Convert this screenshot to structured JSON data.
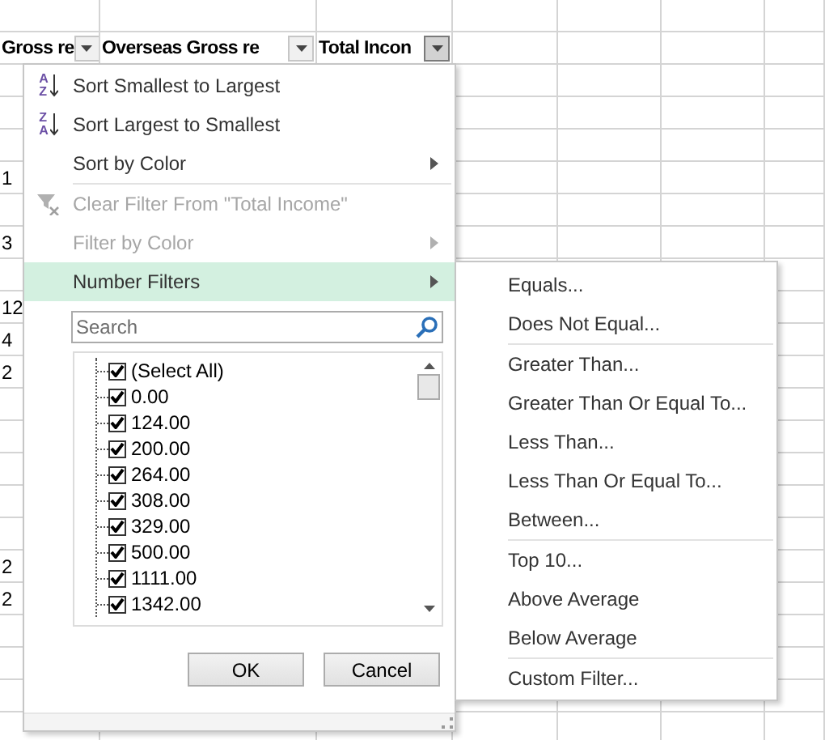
{
  "sheet": {
    "headers": [
      {
        "label": "Gross re",
        "filter_active": false
      },
      {
        "label": "Overseas Gross re",
        "filter_active": false
      },
      {
        "label": "Total Incon",
        "filter_active": true
      }
    ],
    "left_cells": [
      "1",
      "3",
      "12",
      "4",
      "2",
      "2",
      "2"
    ]
  },
  "menu": {
    "items": [
      {
        "kind": "sortasc",
        "label": "Sort Smallest to Largest",
        "icon_letters": [
          "A",
          "Z"
        ],
        "disabled": false,
        "selected": false,
        "submenu": false
      },
      {
        "kind": "sortdesc",
        "label": "Sort Largest to Smallest",
        "icon_letters": [
          "Z",
          "A"
        ],
        "disabled": false,
        "selected": false,
        "submenu": false
      },
      {
        "kind": "plain",
        "label": "Sort by Color",
        "disabled": false,
        "selected": false,
        "submenu": true
      },
      {
        "kind": "separator"
      },
      {
        "kind": "clearfilter",
        "label": "Clear Filter From \"Total Income\"",
        "disabled": true,
        "selected": false,
        "submenu": false
      },
      {
        "kind": "plain",
        "label": "Filter by Color",
        "disabled": true,
        "selected": false,
        "submenu": true
      },
      {
        "kind": "plain",
        "label": "Number Filters",
        "disabled": false,
        "selected": true,
        "submenu": true
      }
    ],
    "search": {
      "placeholder": "Search"
    },
    "values": [
      {
        "label": "(Select All)",
        "checked": true
      },
      {
        "label": "0.00",
        "checked": true
      },
      {
        "label": "124.00",
        "checked": true
      },
      {
        "label": "200.00",
        "checked": true
      },
      {
        "label": "264.00",
        "checked": true
      },
      {
        "label": "308.00",
        "checked": true
      },
      {
        "label": "329.00",
        "checked": true
      },
      {
        "label": "500.00",
        "checked": true
      },
      {
        "label": "1111.00",
        "checked": true
      },
      {
        "label": "1342.00",
        "checked": true
      }
    ],
    "buttons": [
      "OK",
      "Cancel"
    ]
  },
  "submenu": {
    "items": [
      {
        "kind": "item",
        "label": "Equals..."
      },
      {
        "kind": "item",
        "label": "Does Not Equal..."
      },
      {
        "kind": "separator"
      },
      {
        "kind": "item",
        "label": "Greater Than..."
      },
      {
        "kind": "item",
        "label": "Greater Than Or Equal To..."
      },
      {
        "kind": "item",
        "label": "Less Than..."
      },
      {
        "kind": "item",
        "label": "Less Than Or Equal To..."
      },
      {
        "kind": "item",
        "label": "Between..."
      },
      {
        "kind": "separator"
      },
      {
        "kind": "item",
        "label": "Top 10..."
      },
      {
        "kind": "item",
        "label": "Above Average"
      },
      {
        "kind": "item",
        "label": "Below Average"
      },
      {
        "kind": "separator"
      },
      {
        "kind": "item",
        "label": "Custom Filter..."
      }
    ]
  }
}
